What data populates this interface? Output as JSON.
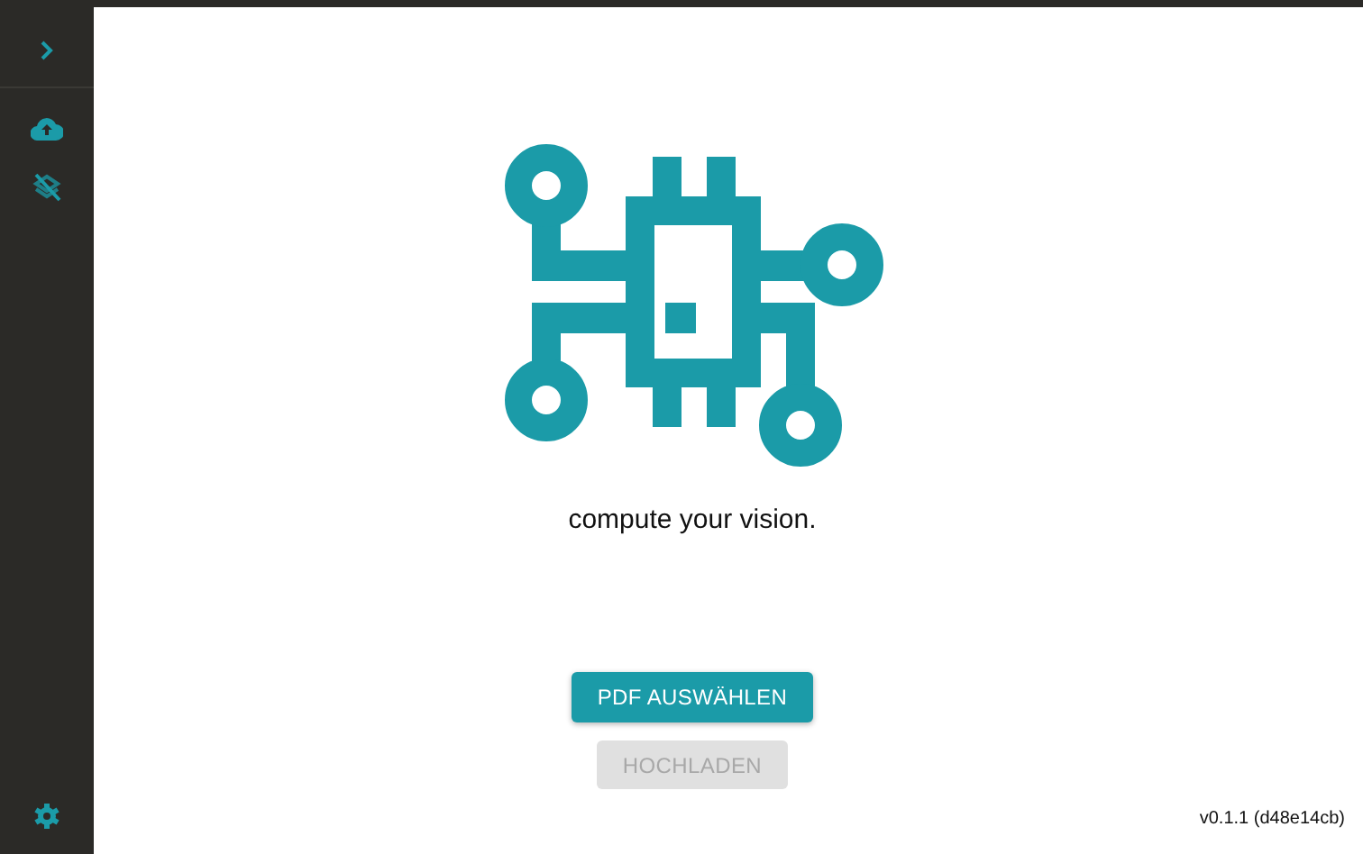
{
  "tagline": "compute your vision.",
  "buttons": [
    {
      "label": "PDF AUSWÄHLEN",
      "disabled": false
    },
    {
      "label": "HOCHLADEN",
      "disabled": true
    }
  ],
  "version": "v0.1.1 (d48e14cb)"
}
